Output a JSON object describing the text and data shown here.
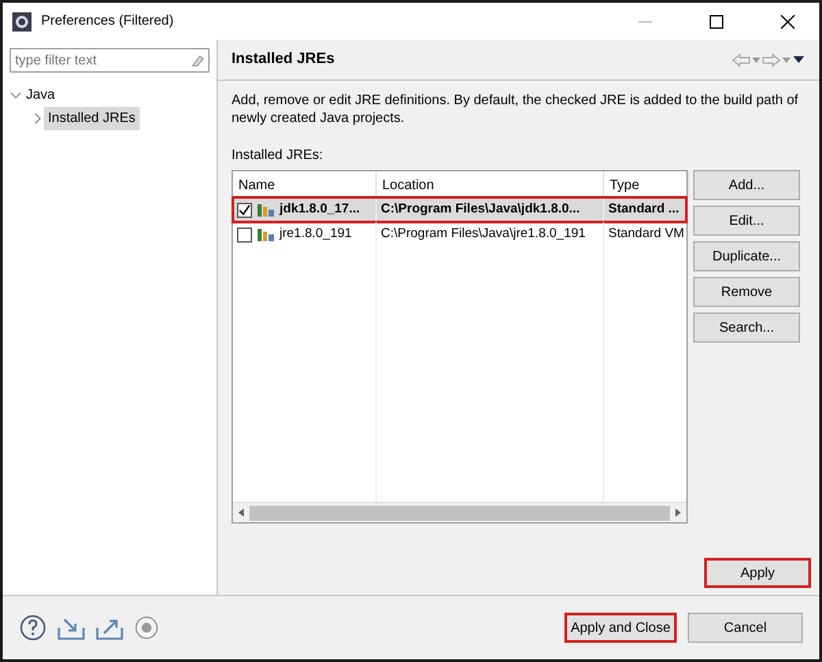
{
  "window": {
    "title": "Preferences (Filtered)"
  },
  "filter": {
    "placeholder": "type filter text"
  },
  "tree": [
    {
      "label": "Java",
      "expanded": true,
      "selected": false,
      "children": [
        {
          "label": "Installed JREs",
          "expanded": false,
          "selected": true
        }
      ]
    }
  ],
  "page": {
    "title": "Installed JREs",
    "description": "Add, remove or edit JRE definitions. By default, the checked JRE is added to the build path of newly created Java projects.",
    "list_label": "Installed JREs:"
  },
  "table": {
    "columns": [
      "Name",
      "Location",
      "Type"
    ],
    "rows": [
      {
        "cells": [
          "jdk1.8.0_17...",
          "C:\\Program Files\\Java\\jdk1.8.0...",
          "Standard ..."
        ],
        "checked": true,
        "selected": true,
        "highlighted": true
      },
      {
        "cells": [
          "jre1.8.0_191",
          "C:\\Program Files\\Java\\jre1.8.0_191",
          "Standard VM"
        ],
        "checked": false,
        "selected": false,
        "highlighted": false
      }
    ]
  },
  "side_buttons": [
    {
      "label": "Add..."
    },
    {
      "label": "Edit..."
    },
    {
      "label": "Duplicate..."
    },
    {
      "label": "Remove"
    },
    {
      "label": "Search..."
    }
  ],
  "apply": {
    "label": "Apply",
    "highlighted": true
  },
  "footer_buttons": [
    {
      "label": "Apply and Close",
      "highlighted": true
    },
    {
      "label": "Cancel",
      "highlighted": false
    }
  ]
}
